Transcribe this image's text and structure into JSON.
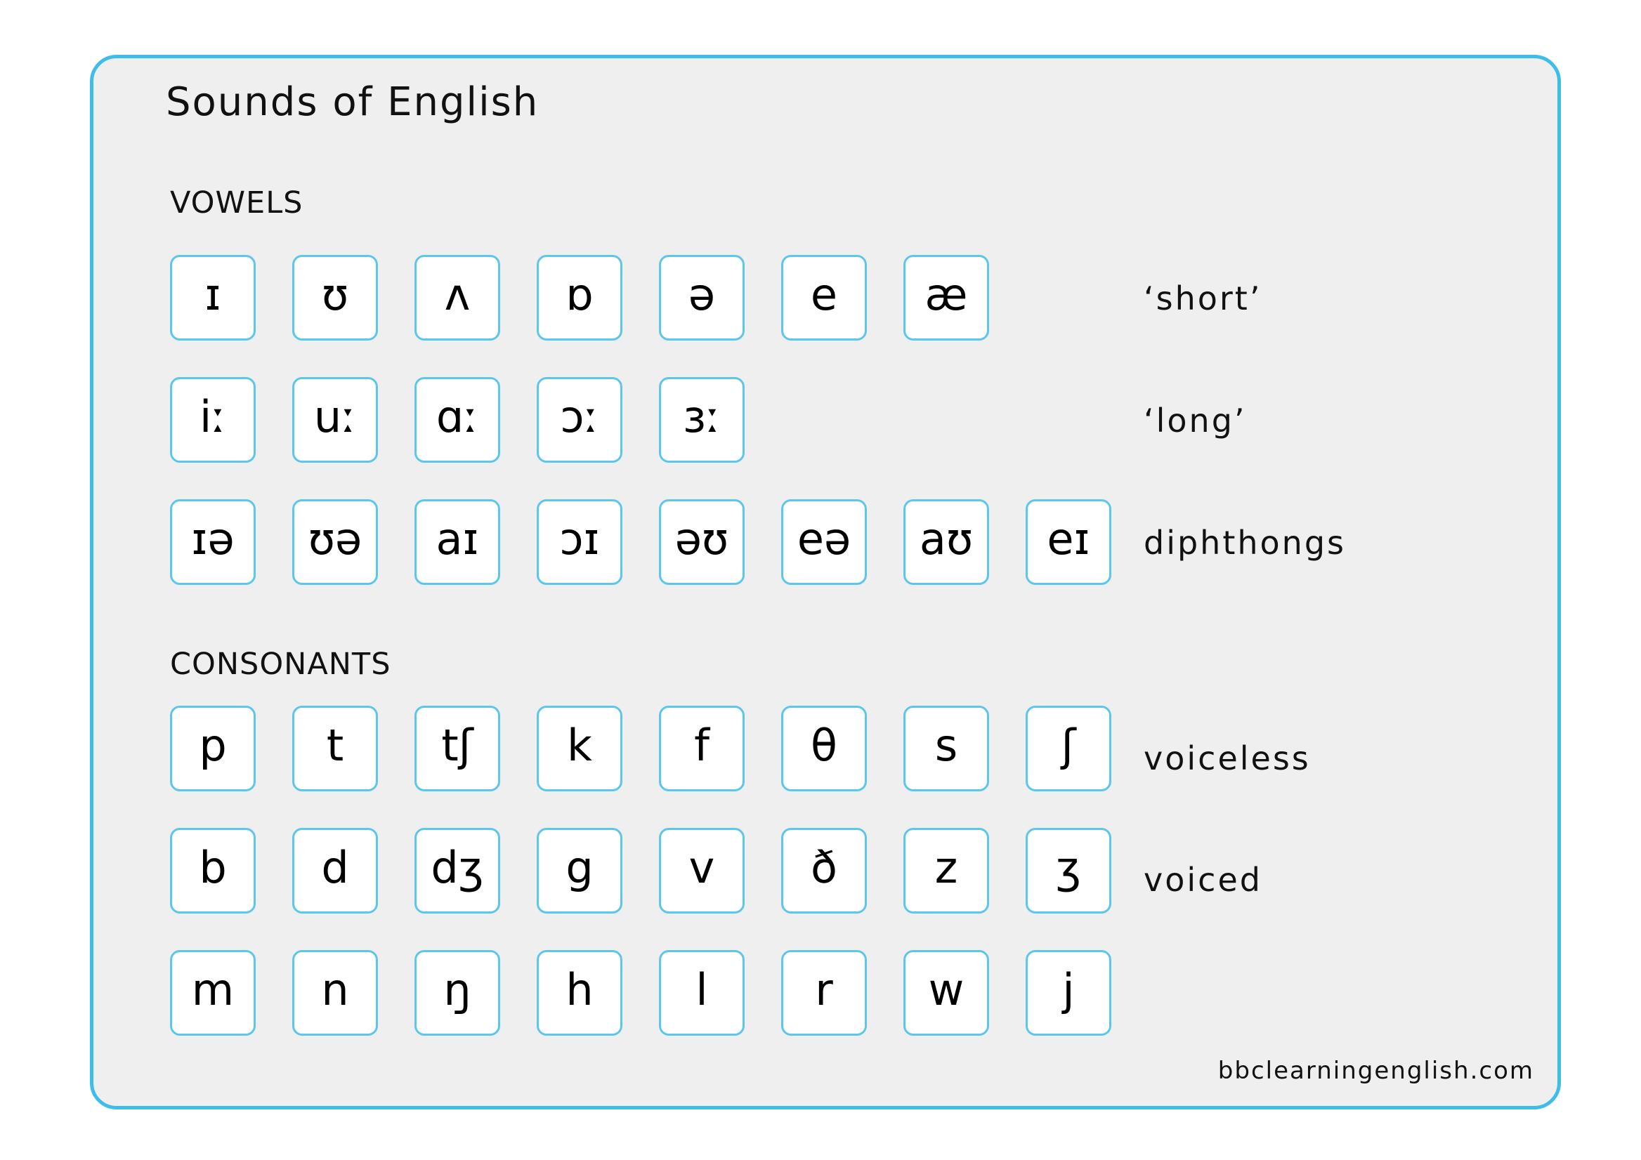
{
  "title": "Sounds of English",
  "colors": {
    "border": "#3EBDEB",
    "tile_border": "#5CC6EC",
    "panel_bg": "#EFEFEF"
  },
  "vowels": {
    "heading": "VOWELS",
    "rows": [
      {
        "label": "‘short’",
        "symbols": [
          "ɪ",
          "ʊ",
          "ʌ",
          "ɒ",
          "ə",
          "e",
          "æ"
        ]
      },
      {
        "label": "‘long’",
        "symbols": [
          "iː",
          "uː",
          "ɑː",
          "ɔː",
          "ɜː"
        ]
      },
      {
        "label": "diphthongs",
        "symbols": [
          "ɪə",
          "ʊə",
          "aɪ",
          "ɔɪ",
          "əʊ",
          "eə",
          "aʊ",
          "eɪ"
        ]
      }
    ]
  },
  "consonants": {
    "heading": "CONSONANTS",
    "rows": [
      {
        "label": "voiceless",
        "symbols": [
          "p",
          "t",
          "tʃ",
          "k",
          "f",
          "θ",
          "s",
          "ʃ"
        ]
      },
      {
        "label": "voiced",
        "symbols": [
          "b",
          "d",
          "dʒ",
          "g",
          "v",
          "ð",
          "z",
          "ʒ"
        ]
      },
      {
        "label": "",
        "symbols": [
          "m",
          "n",
          "ŋ",
          "h",
          "l",
          "r",
          "w",
          "j"
        ]
      }
    ]
  },
  "footer": "bbclearningenglish.com"
}
